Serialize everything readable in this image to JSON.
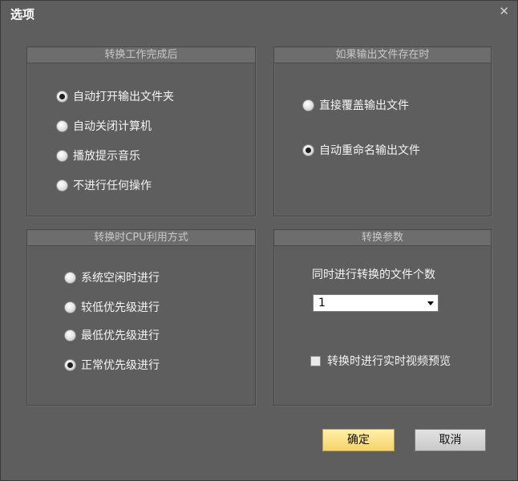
{
  "window": {
    "title": "选项",
    "close_glyph": "✕"
  },
  "groups": {
    "after_finish": {
      "header": "转换工作完成后",
      "options": [
        {
          "label": "自动打开输出文件夹",
          "checked": true
        },
        {
          "label": "自动关闭计算机",
          "checked": false
        },
        {
          "label": "播放提示音乐",
          "checked": false
        },
        {
          "label": "不进行任何操作",
          "checked": false
        }
      ]
    },
    "output_exists": {
      "header": "如果输出文件存在时",
      "options": [
        {
          "label": "直接覆盖输出文件",
          "checked": false
        },
        {
          "label": "自动重命名输出文件",
          "checked": true
        }
      ]
    },
    "cpu_mode": {
      "header": "转换时CPU利用方式",
      "options": [
        {
          "label": "系统空闲时进行",
          "checked": false
        },
        {
          "label": "较低优先级进行",
          "checked": false
        },
        {
          "label": "最低优先级进行",
          "checked": false
        },
        {
          "label": "正常优先级进行",
          "checked": true
        }
      ]
    },
    "params": {
      "header": "转换参数",
      "concurrent_label": "同时进行转换的文件个数",
      "concurrent_value": "1",
      "preview_label": "转换时进行实时视频预览",
      "preview_checked": false
    }
  },
  "buttons": {
    "ok": "确定",
    "cancel": "取消"
  }
}
